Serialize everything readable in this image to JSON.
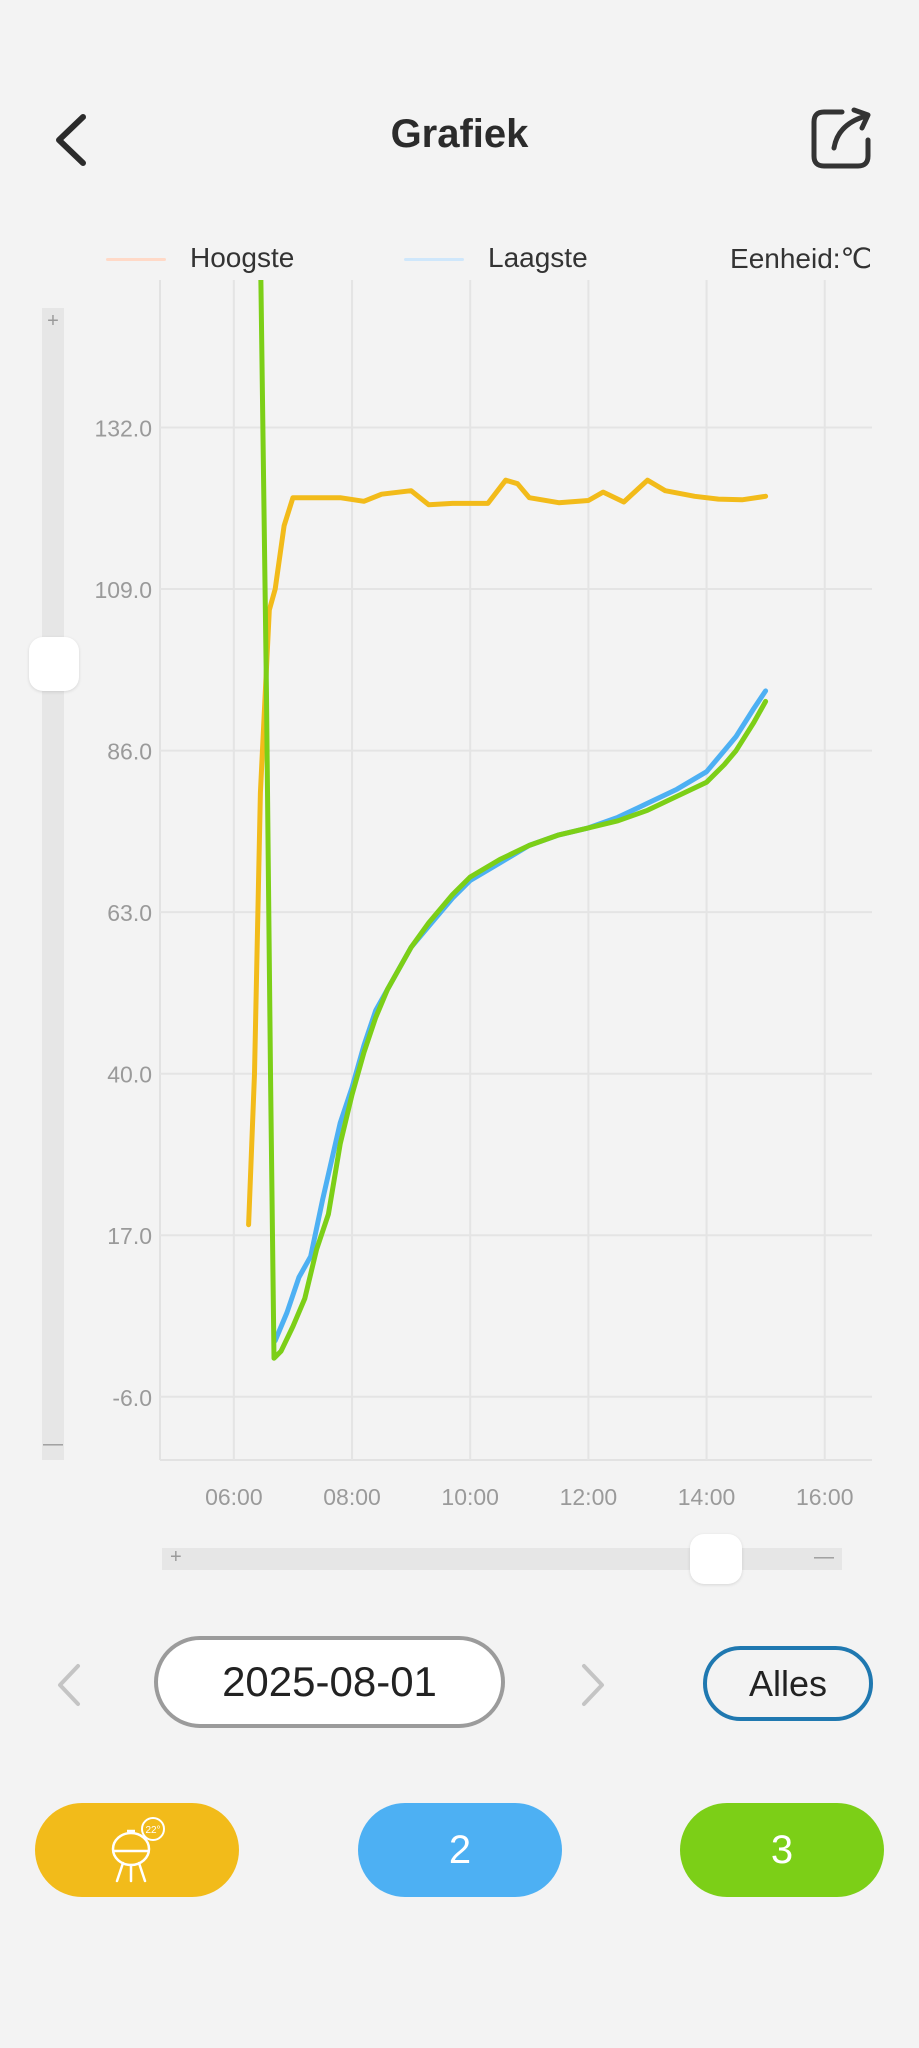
{
  "header": {
    "title": "Grafiek",
    "back_icon": "chevron-left-icon",
    "share_icon": "share-icon"
  },
  "legend": {
    "high_label": "Hoogste",
    "high_color": "#ffd9c7",
    "low_label": "Laagste",
    "low_color": "#cfe7fb",
    "unit_label": "Eenheid:℃"
  },
  "chart_data": {
    "type": "line",
    "x_unit": "time of day (hours)",
    "y_unit": "℃",
    "xlim": [
      4.75,
      16.8
    ],
    "ylim": [
      -15,
      153
    ],
    "y_ticks": [
      {
        "value": 132,
        "label": "132.0"
      },
      {
        "value": 109,
        "label": "109.0"
      },
      {
        "value": 86,
        "label": "86.0"
      },
      {
        "value": 63,
        "label": "63.0"
      },
      {
        "value": 40,
        "label": "40.0"
      },
      {
        "value": 17,
        "label": "17.0"
      },
      {
        "value": -6,
        "label": "-6.0"
      }
    ],
    "x_ticks": [
      {
        "value": 6,
        "label": "06:00"
      },
      {
        "value": 8,
        "label": "08:00"
      },
      {
        "value": 10,
        "label": "10:00"
      },
      {
        "value": 12,
        "label": "12:00"
      },
      {
        "value": 14,
        "label": "14:00"
      },
      {
        "value": 16,
        "label": "16:00"
      }
    ],
    "grid": true,
    "series": [
      {
        "id": "probe-1",
        "color": "#f2bb1a",
        "points": [
          [
            6.25,
            18.5
          ],
          [
            6.35,
            40
          ],
          [
            6.45,
            80
          ],
          [
            6.6,
            106
          ],
          [
            6.7,
            109
          ],
          [
            6.85,
            118
          ],
          [
            7.0,
            122
          ],
          [
            7.5,
            122
          ],
          [
            7.8,
            122
          ],
          [
            8.2,
            121.5
          ],
          [
            8.5,
            122.5
          ],
          [
            9.0,
            123
          ],
          [
            9.3,
            121
          ],
          [
            9.7,
            121.2
          ],
          [
            10.3,
            121.2
          ],
          [
            10.6,
            124.5
          ],
          [
            10.8,
            124
          ],
          [
            11.0,
            122
          ],
          [
            11.5,
            121.3
          ],
          [
            12.0,
            121.6
          ],
          [
            12.25,
            122.8
          ],
          [
            12.6,
            121.4
          ],
          [
            13.0,
            124.5
          ],
          [
            13.3,
            123
          ],
          [
            13.8,
            122.2
          ],
          [
            14.2,
            121.8
          ],
          [
            14.6,
            121.7
          ],
          [
            15.0,
            122.2
          ]
        ]
      },
      {
        "id": "probe-2",
        "color": "#4db0f3",
        "points": [
          [
            6.7,
            2
          ],
          [
            6.9,
            6
          ],
          [
            7.1,
            11
          ],
          [
            7.3,
            14
          ],
          [
            7.5,
            22
          ],
          [
            7.8,
            33
          ],
          [
            8.0,
            38
          ],
          [
            8.2,
            44
          ],
          [
            8.4,
            49
          ],
          [
            8.6,
            52
          ],
          [
            9.0,
            58
          ],
          [
            9.3,
            61
          ],
          [
            9.7,
            65
          ],
          [
            10.0,
            67.5
          ],
          [
            10.5,
            70
          ],
          [
            11.0,
            72.5
          ],
          [
            11.5,
            74
          ],
          [
            12.0,
            75
          ],
          [
            12.5,
            76.5
          ],
          [
            13.0,
            78.5
          ],
          [
            13.5,
            80.5
          ],
          [
            14.0,
            83
          ],
          [
            14.3,
            86
          ],
          [
            14.5,
            88
          ],
          [
            14.8,
            92
          ],
          [
            15.0,
            94.5
          ]
        ]
      },
      {
        "id": "probe-3",
        "color": "#7ccf17",
        "points": [
          [
            6.45,
            158
          ],
          [
            6.55,
            95
          ],
          [
            6.62,
            40
          ],
          [
            6.68,
            -0.5
          ],
          [
            6.8,
            0.5
          ],
          [
            7.0,
            4
          ],
          [
            7.2,
            8
          ],
          [
            7.4,
            15
          ],
          [
            7.6,
            20
          ],
          [
            7.8,
            30
          ],
          [
            8.0,
            37
          ],
          [
            8.2,
            43
          ],
          [
            8.4,
            48
          ],
          [
            8.6,
            52
          ],
          [
            9.0,
            58
          ],
          [
            9.3,
            61.5
          ],
          [
            9.7,
            65.5
          ],
          [
            10.0,
            68
          ],
          [
            10.5,
            70.5
          ],
          [
            11.0,
            72.5
          ],
          [
            11.5,
            74
          ],
          [
            12.0,
            75
          ],
          [
            12.5,
            76
          ],
          [
            13.0,
            77.5
          ],
          [
            13.5,
            79.5
          ],
          [
            14.0,
            81.5
          ],
          [
            14.3,
            84
          ],
          [
            14.5,
            86
          ],
          [
            14.8,
            90
          ],
          [
            15.0,
            93
          ]
        ]
      }
    ]
  },
  "date_nav": {
    "prev_icon": "chevron-left-icon",
    "next_icon": "chevron-right-icon",
    "date": "2025-08-01",
    "all_label": "Alles"
  },
  "sliders": {
    "vertical_level": 0.7,
    "horizontal_level": 0.84
  },
  "probes": [
    {
      "label": "",
      "icon": "grill-icon",
      "badge": "22°",
      "color": "#f2bb1a"
    },
    {
      "label": "2",
      "color": "#4db0f3"
    },
    {
      "label": "3",
      "color": "#7ccf17"
    }
  ]
}
